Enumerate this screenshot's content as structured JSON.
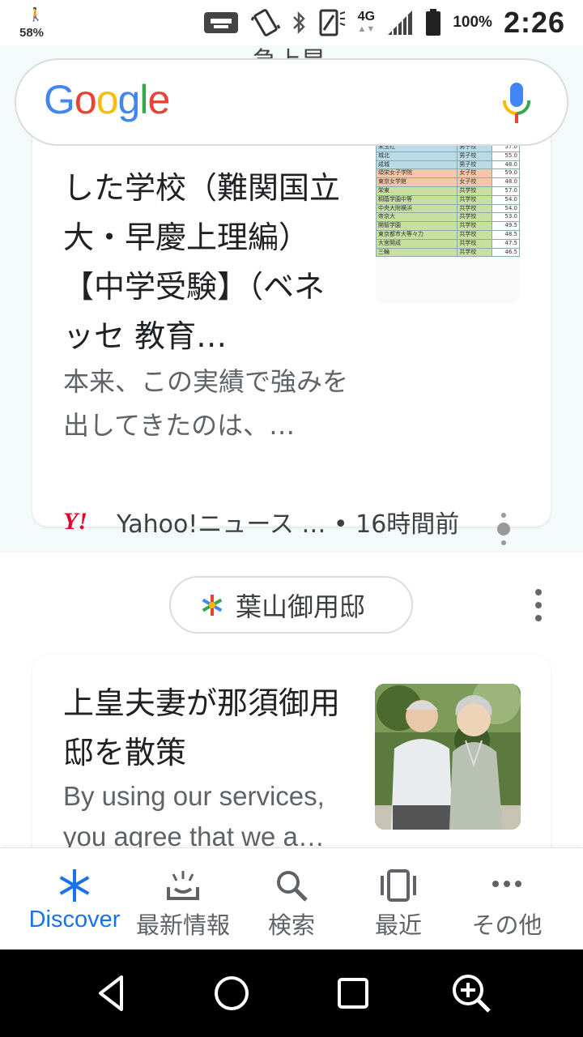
{
  "status_bar": {
    "left_percent": "58%",
    "network": "4G",
    "battery": "100%",
    "time": "2:26"
  },
  "search": {
    "logo_letters": [
      {
        "ch": "G",
        "color": "#4285F4"
      },
      {
        "ch": "o",
        "color": "#EA4335"
      },
      {
        "ch": "o",
        "color": "#FBBC05"
      },
      {
        "ch": "g",
        "color": "#4285F4"
      },
      {
        "ch": "l",
        "color": "#34A853"
      },
      {
        "ch": "e",
        "color": "#EA4335"
      }
    ]
  },
  "feed": {
    "peek_title": "急上昇",
    "card1": {
      "title": "した学校（難関国立大・早慶上理編）【中学受験】（ベネッセ 教育…",
      "snippet": "本来、この実績で強みを出してきたのは、…",
      "source": "Yahoo!ニュース … • 16時間前",
      "source_logo": "Y!",
      "thumb_rows": [
        {
          "name": "栄玉社",
          "type": "男子校",
          "score": "57.0",
          "color": "#b9dbe7"
        },
        {
          "name": "城北",
          "type": "男子校",
          "score": "55.0",
          "color": "#b9dbe7"
        },
        {
          "name": "成城",
          "type": "男子校",
          "score": "48.0",
          "color": "#b9dbe7"
        },
        {
          "name": "頌栄女子学院",
          "type": "女子校",
          "score": "59.0",
          "color": "#f6c6a8"
        },
        {
          "name": "東京女学館",
          "type": "女子校",
          "score": "48.0",
          "color": "#f6c6a8"
        },
        {
          "name": "栄東",
          "type": "共学校",
          "score": "57.0",
          "color": "#c7df9f"
        },
        {
          "name": "桐蔭学園中等",
          "type": "共学校",
          "score": "54.0",
          "color": "#c7df9f"
        },
        {
          "name": "中央大附横浜",
          "type": "共学校",
          "score": "54.0",
          "color": "#c7df9f"
        },
        {
          "name": "帝京大",
          "type": "共学校",
          "score": "53.0",
          "color": "#c7df9f"
        },
        {
          "name": "開智学園",
          "type": "共学校",
          "score": "49.5",
          "color": "#c7df9f"
        },
        {
          "name": "東京都市大等々力",
          "type": "共学校",
          "score": "48.5",
          "color": "#c7df9f"
        },
        {
          "name": "大宮開成",
          "type": "共学校",
          "score": "47.5",
          "color": "#c7df9f"
        },
        {
          "name": "三輪",
          "type": "共学校",
          "score": "46.5",
          "color": "#c7df9f"
        }
      ]
    },
    "topic": {
      "label": "葉山御用邸"
    },
    "card2": {
      "title": "上皇夫妻が那須御用邸を散策",
      "snippet": "By using our services, you agree that we a…"
    }
  },
  "bottom_nav": [
    {
      "label": "Discover",
      "icon": "asterisk-icon",
      "active": true
    },
    {
      "label": "最新情報",
      "icon": "updates-tray-icon",
      "active": false
    },
    {
      "label": "検索",
      "icon": "search-icon",
      "active": false
    },
    {
      "label": "最近",
      "icon": "recent-cards-icon",
      "active": false
    },
    {
      "label": "その他",
      "icon": "more-dots-icon",
      "active": false
    }
  ],
  "colors": {
    "accent": "#1a73e8",
    "yahoo_red": "#e5002d",
    "mic_blue": "#4285F4",
    "mic_red": "#EA4335",
    "mic_yellow": "#FBBC05",
    "mic_green": "#34A853"
  }
}
